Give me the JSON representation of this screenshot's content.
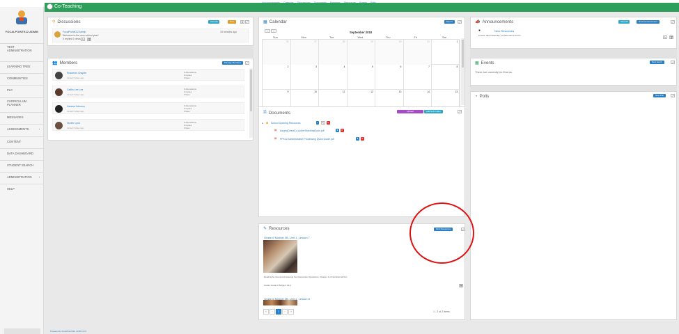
{
  "topnav": {
    "items": [
      "Announcements",
      "Calendar",
      "Discussions",
      "Documents",
      "Members",
      "Resources",
      "Events",
      "Polls"
    ]
  },
  "community": {
    "title": "Co-Teaching"
  },
  "sidebar": {
    "user": "FOCALPOINTK12 ADMIN",
    "items": [
      {
        "label": "TEST ADMINISTRATION",
        "arrow": ""
      },
      {
        "label": "LEARNING TREE",
        "arrow": ""
      },
      {
        "label": "COMMUNITIES",
        "arrow": ""
      },
      {
        "label": "PLC",
        "arrow": ""
      },
      {
        "label": "CURRICULUM PLANNER",
        "arrow": ""
      },
      {
        "label": "MESSAGES",
        "arrow": ""
      },
      {
        "label": "ASSESSMENTS",
        "arrow": "›"
      },
      {
        "label": "CONTENT",
        "arrow": ""
      },
      {
        "label": "DATA DASHBOARD",
        "arrow": ""
      },
      {
        "label": "STUDENT SEARCH",
        "arrow": ""
      },
      {
        "label": "ADMINISTRATION",
        "arrow": "›"
      },
      {
        "label": "HELP",
        "arrow": ""
      }
    ]
  },
  "discussions": {
    "title": "Discussions",
    "view_all": "View All",
    "new": "New",
    "post_author": "FocalPointK12 Admin",
    "post_text": "Welcome to the new school year!",
    "post_meta": "0 replies  0 views",
    "post_time": "15 minutes ago"
  },
  "members": {
    "title": "Members",
    "manage": "Manage Members",
    "list": [
      {
        "name": "Rosamon Chapter",
        "joined": "Joined 5 days ago",
        "stats": [
          "0 discussions",
          "0 replies",
          "0 likes"
        ]
      },
      {
        "name": "Caitlin Lee Lee",
        "joined": "Joined 5 days ago",
        "stats": [
          "0 discussions",
          "0 replies",
          "0 likes"
        ]
      },
      {
        "name": "Vanesa Johnson",
        "joined": "Joined 5 days ago",
        "stats": [
          "0 discussions",
          "0 replies",
          "0 likes"
        ]
      },
      {
        "name": "Hunter Lynn",
        "joined": "Joined 5 days ago",
        "stats": [
          "0 discussions",
          "0 replies",
          "0 likes"
        ]
      }
    ]
  },
  "calendar": {
    "title": "Calendar",
    "export": "Export",
    "month": "September 2018",
    "days": [
      "Sun",
      "Mon",
      "Tue",
      "Wed",
      "Thu",
      "Fri",
      "Sat"
    ],
    "weeks": [
      [
        "26",
        "27",
        "28",
        "29",
        "30",
        "31",
        "1"
      ],
      [
        "2",
        "3",
        "4",
        "5",
        "6",
        "7",
        "8"
      ],
      [
        "9",
        "10",
        "11",
        "12",
        "13",
        "14",
        "15"
      ]
    ],
    "grey_first_row_count": 6
  },
  "documents": {
    "title": "Documents",
    "upload": "Upload",
    "add_folder": "Add Sub Folder",
    "folder": "School Opening Resources",
    "files": [
      "AssessDirectCo-ActiveTeachingTools.pdf",
      "FPK12 Administrative Processing Quick Guide.pdf"
    ]
  },
  "resources": {
    "title": "Resources",
    "find": "Find Resources",
    "item1_title": "Grade 6 Module 3B, Unit 1, Lesson 7",
    "item1_desc": "Reading for Gist and Answering Text-Dependent Questions: Chapter 4 of Nonfictional Text",
    "item1_meta": "Grade: Grade 6    Subject: ELA",
    "item2_title": "Grade 6 Module 3B, Unit 1, Lesson 8",
    "count": "1 - 2 of 2 items",
    "pages": [
      "«",
      "‹",
      "1",
      "›",
      "»"
    ]
  },
  "announcements": {
    "title": "Announcements",
    "view_all": "View All",
    "new": "New Announcement",
    "item_title": "New Resources",
    "item_meta": "Posted: 08/17/2018    By: FocalPointK12 Admin"
  },
  "events": {
    "title": "Events",
    "new": "New Event",
    "empty": "There are currently no Events."
  },
  "polls": {
    "title": "Polls",
    "new": "New Poll"
  },
  "footer": "Powered by FocalPointK12 LCMS v3.0"
}
